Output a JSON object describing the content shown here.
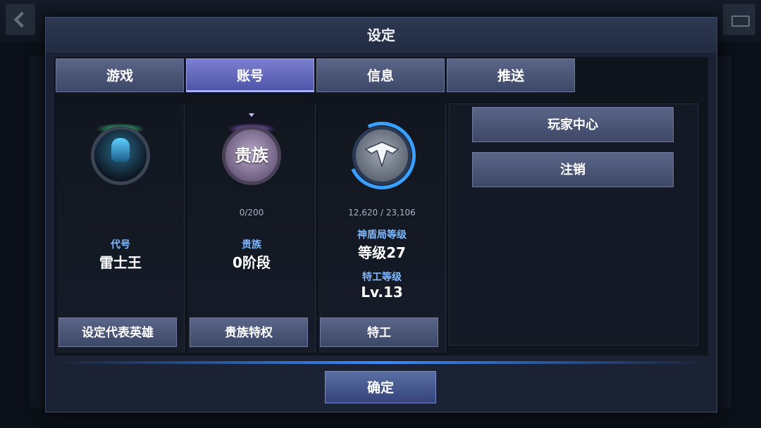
{
  "dialog": {
    "title": "设定"
  },
  "tabs": [
    {
      "label": "游戏",
      "active": false
    },
    {
      "label": "账号",
      "active": true
    },
    {
      "label": "信息",
      "active": false
    },
    {
      "label": "推送",
      "active": false
    }
  ],
  "profile": {
    "codename_label": "代号",
    "codename_value": "雷士王",
    "button_label": "设定代表英雄"
  },
  "noble": {
    "emblem_text": "贵族",
    "progress": "0/200",
    "label": "贵族",
    "stage_value": "0阶段",
    "button_label": "贵族特权"
  },
  "shield": {
    "progress": "12,620 / 23,106",
    "level_label": "神盾局等级",
    "level_value": "等级27",
    "agent_label": "特工等级",
    "agent_value": "Lv.13",
    "button_label": "特工"
  },
  "account_actions": {
    "player_center": "玩家中心",
    "logout": "注销"
  },
  "footer": {
    "confirm": "确定"
  },
  "colors": {
    "accent_blue": "#3a8cff",
    "label_blue": "#7fb8ff",
    "tab_active": "#6a6fc4"
  }
}
